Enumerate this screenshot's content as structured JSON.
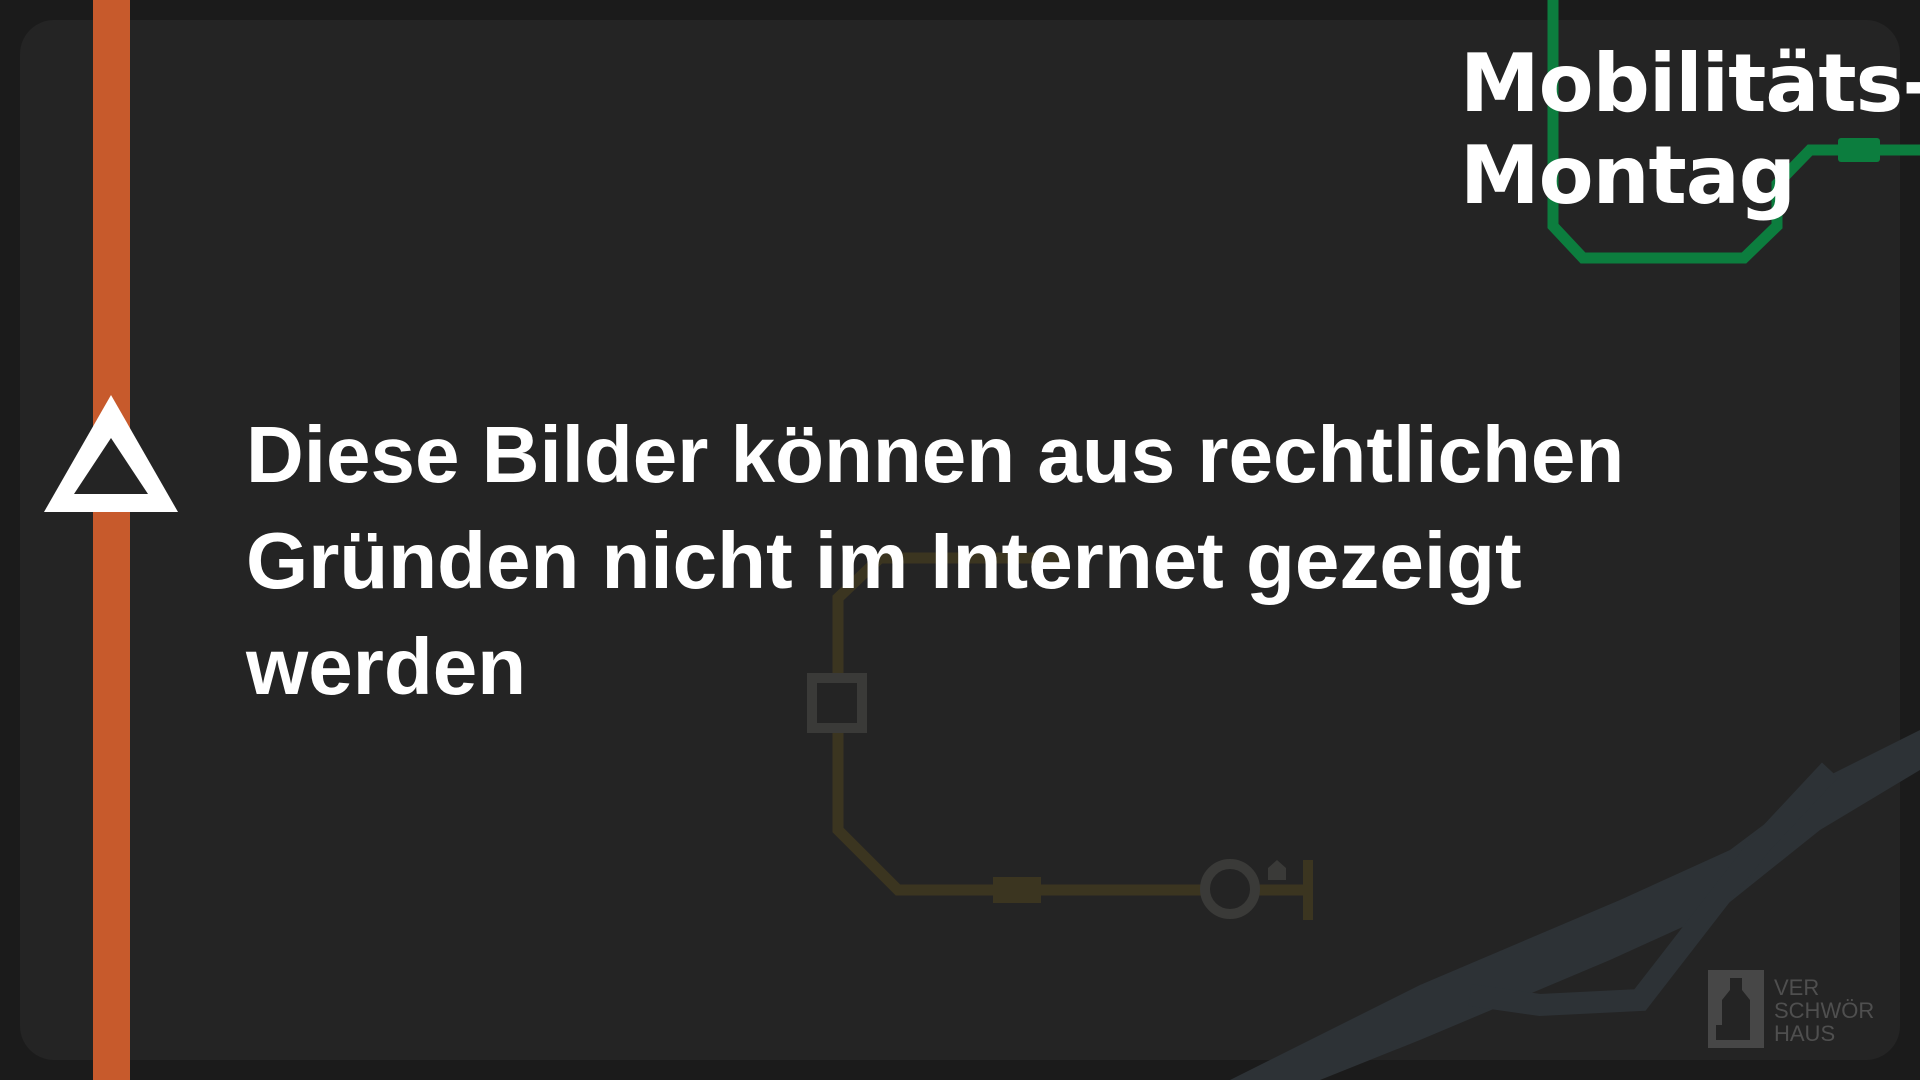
{
  "title": {
    "line1": "Mobilitäts-",
    "line2": "Montag"
  },
  "notice": {
    "text": "Diese Bilder können aus rechtlichen Gründen nicht im Internet gezeigt werden"
  },
  "logo": {
    "line1": "VER",
    "line2": "SCHWÖR",
    "line3": "HAUS"
  },
  "icons": {
    "warning": "warning-triangle-icon",
    "logo": "verschwoerhaus-house-icon"
  },
  "colors": {
    "background": "#242424",
    "orange_line": "#c75a2c",
    "green_line": "#0c7d3e",
    "brown_line": "#3f3922",
    "blue_river": "#2d3236",
    "text": "#ffffff"
  }
}
